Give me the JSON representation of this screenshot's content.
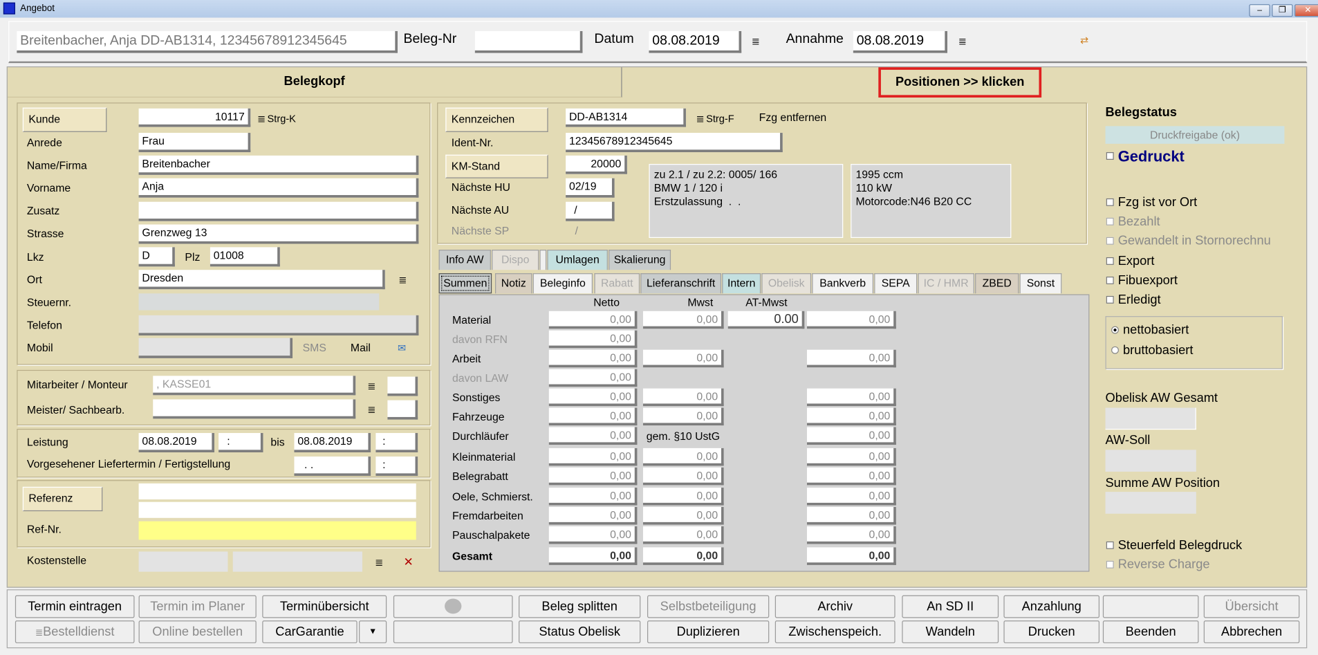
{
  "window": {
    "title": "Angebot",
    "buttons": [
      "minimize",
      "restore",
      "close"
    ]
  },
  "topbar": {
    "customer_summary": "Breitenbacher, Anja DD-AB1314, 12345678912345645",
    "beleg_nr_label": "Beleg-Nr",
    "beleg_nr": "",
    "datum_label": "Datum",
    "datum": "08.08.2019",
    "annahme_label": "Annahme",
    "annahme": "08.08.2019"
  },
  "header": {
    "belegkopf": "Belegkopf",
    "positionen": "Positionen >> klicken",
    "highlight_color": "#e02020"
  },
  "customer": {
    "kunde_button": "Kunde",
    "kunde": "10117",
    "kunde_shortcut": "Strg-K",
    "anrede_label": "Anrede",
    "anrede": "Frau",
    "name_label": "Name/Firma",
    "name": "Breitenbacher",
    "vorname_label": "Vorname",
    "vorname": "Anja",
    "zusatz_label": "Zusatz",
    "zusatz": "",
    "strasse_label": "Strasse",
    "strasse": "Grenzweg 13",
    "lkz_label": "Lkz",
    "lkz": "D",
    "plz_label": "Plz",
    "plz": "01008",
    "ort_label": "Ort",
    "ort": "Dresden",
    "steuernr_label": "Steuernr.",
    "steuernr": "",
    "telefon_label": "Telefon",
    "telefon": "",
    "mobil_label": "Mobil",
    "mobil": "",
    "sms_label": "SMS",
    "mail_label": "Mail"
  },
  "staff": {
    "mitarbeiter_label": "Mitarbeiter / Monteur",
    "mitarbeiter": ", KASSE01",
    "meister_label": "Meister/ Sachbearb.",
    "meister": ""
  },
  "dates": {
    "leistung_label": "Leistung",
    "leistung_von": "08.08.2019",
    "leistung_von_zeit": ":",
    "bis_label": "bis",
    "leistung_bis": "08.08.2019",
    "leistung_bis_zeit": ":",
    "liefertermin_label": "Vorgesehener Liefertermin / Fertigstellung",
    "liefertermin": ". .",
    "liefertermin_zeit": ":"
  },
  "reference": {
    "referenz_button": "Referenz",
    "referenz1": "",
    "referenz2": "",
    "refnr_label": "Ref-Nr.",
    "refnr": "",
    "kostenstelle_label": "Kostenstelle"
  },
  "vehicle": {
    "kennzeichen_button": "Kennzeichen",
    "kennzeichen": "DD-AB1314",
    "kennzeichen_shortcut": "Strg-F",
    "fzg_entfernen": "Fzg entfernen",
    "ident_label": "Ident-Nr.",
    "ident": "12345678912345645",
    "km_button": "KM-Stand",
    "km": "20000",
    "hu_label": "Nächste HU",
    "hu": "02/19",
    "au_label": "Nächste AU",
    "au": "/",
    "sp_label": "Nächste SP",
    "sp": "/",
    "info1": [
      "zu 2.1 / zu 2.2: 0005/ 166",
      "BMW 1 / 120 i",
      "Erstzulassung  .  ."
    ],
    "info2": [
      "1995 ccm",
      "110 kW",
      "Motorcode:N46 B20 CC"
    ]
  },
  "tabs_row1": [
    {
      "label": "Info AW",
      "state": "normal"
    },
    {
      "label": "Dispo",
      "state": "disabled"
    },
    {
      "label": "",
      "state": "blank"
    },
    {
      "label": "Umlagen",
      "state": "teal"
    },
    {
      "label": "Skalierung",
      "state": "normal"
    }
  ],
  "tabs_row2": [
    {
      "label": "Summen",
      "state": "active"
    },
    {
      "label": "Notiz",
      "state": "tan"
    },
    {
      "label": "Beleginfo",
      "state": "light"
    },
    {
      "label": "Rabatt",
      "state": "disabled"
    },
    {
      "label": "Lieferanschrift",
      "state": "normal"
    },
    {
      "label": "Intern",
      "state": "teal"
    },
    {
      "label": "Obelisk",
      "state": "disabled"
    },
    {
      "label": "Bankverb",
      "state": "light"
    },
    {
      "label": "SEPA",
      "state": "light"
    },
    {
      "label": "IC / HMR",
      "state": "disabled"
    },
    {
      "label": "ZBED",
      "state": "tan"
    },
    {
      "label": "Sonst",
      "state": "light"
    }
  ],
  "summen": {
    "headers": [
      "Netto",
      "Mwst",
      "AT-Mwst"
    ],
    "rows": [
      {
        "label": "Material",
        "netto": "0,00",
        "mwst": "0,00",
        "at_mwst": "0.00",
        "extra": "0,00"
      },
      {
        "label": "davon RFN",
        "dim": true,
        "netto": "0,00"
      },
      {
        "label": "Arbeit",
        "netto": "0,00",
        "mwst": "0,00",
        "extra": "0,00"
      },
      {
        "label": "davon LAW",
        "dim": true,
        "netto": "0,00"
      },
      {
        "label": "Sonstiges",
        "netto": "0,00",
        "mwst": "0,00",
        "extra": "0,00"
      },
      {
        "label": "Fahrzeuge",
        "netto": "0,00",
        "mwst": "0,00",
        "extra": "0,00"
      },
      {
        "label": "Durchläufer",
        "netto": "0,00",
        "note": "gem. §10 UstG",
        "extra": "0,00"
      },
      {
        "label": "Kleinmaterial",
        "netto": "0,00",
        "mwst": "0,00",
        "extra": "0,00"
      },
      {
        "label": "Belegrabatt",
        "netto": "0,00",
        "mwst": "0,00",
        "extra": "0,00"
      },
      {
        "label": "Oele, Schmierst.",
        "netto": "0,00",
        "mwst": "0,00",
        "extra": "0,00"
      },
      {
        "label": "Fremdarbeiten",
        "netto": "0,00",
        "mwst": "0,00",
        "extra": "0,00"
      },
      {
        "label": "Pauschalpakete",
        "netto": "0,00",
        "mwst": "0,00",
        "extra": "0,00"
      },
      {
        "label": "Gesamt",
        "bold": true,
        "netto": "0,00",
        "mwst": "0,00",
        "extra": "0,00"
      }
    ]
  },
  "status": {
    "title": "Belegstatus",
    "druckfreigabe": "Druckfreigabe (ok)",
    "gedruckt": "Gedruckt",
    "checks": [
      {
        "label": "Fzg ist vor Ort",
        "checked": false,
        "disabled": false
      },
      {
        "label": "Bezahlt",
        "checked": false,
        "disabled": true
      },
      {
        "label": "Gewandelt in Stornorechnu",
        "checked": false,
        "disabled": true
      },
      {
        "label": "Export",
        "checked": false,
        "disabled": false
      },
      {
        "label": "Fibuexport",
        "checked": false,
        "disabled": false
      },
      {
        "label": "Erledigt",
        "checked": false,
        "disabled": false
      }
    ],
    "basis": [
      {
        "label": "nettobasiert",
        "selected": true
      },
      {
        "label": "bruttobasiert",
        "selected": false
      }
    ],
    "obelisk_aw_label": "Obelisk AW Gesamt",
    "aw_soll_label": "AW-Soll",
    "summe_aw_label": "Summe AW Position",
    "steuerfeld": "Steuerfeld Belegdruck",
    "reverse_charge": "Reverse Charge"
  },
  "buttons_row1": [
    {
      "label": "Termin eintragen"
    },
    {
      "label": "Termin im Planer",
      "disabled": true
    },
    {
      "label": "Terminübersicht"
    },
    {
      "label": "",
      "icon": "globe-icon"
    },
    {
      "label": "Beleg splitten"
    },
    {
      "label": "Selbstbeteiligung",
      "disabled": true
    },
    {
      "label": "Archiv"
    },
    {
      "label": "An SD II"
    },
    {
      "label": "Anzahlung"
    },
    {
      "label": ""
    },
    {
      "label": "Übersicht",
      "disabled": true
    }
  ],
  "buttons_row2": [
    {
      "label": "Bestelldienst",
      "disabled": true
    },
    {
      "label": "Online bestellen",
      "disabled": true
    },
    {
      "label": "CarGarantie",
      "dropdown": true
    },
    {
      "label": ""
    },
    {
      "label": "Status Obelisk"
    },
    {
      "label": "Duplizieren"
    },
    {
      "label": "Zwischenspeich."
    },
    {
      "label": "Wandeln"
    },
    {
      "label": "Drucken"
    },
    {
      "label": "Beenden"
    },
    {
      "label": "Abbrechen"
    }
  ]
}
